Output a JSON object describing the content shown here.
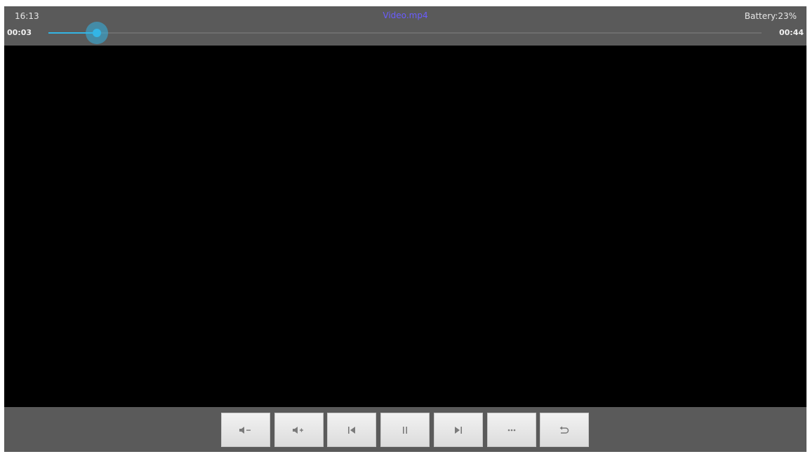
{
  "status_bar": {
    "clock": "16:13",
    "title": "Video.mp4",
    "battery": "Battery:23%"
  },
  "playback": {
    "elapsed": "00:03",
    "total": "00:44",
    "progress_fraction": 0.0682
  },
  "controls": [
    {
      "name": "volume-down-button",
      "icon": "volume-down-icon"
    },
    {
      "name": "volume-up-button",
      "icon": "volume-up-icon"
    },
    {
      "name": "previous-button",
      "icon": "skip-previous-icon"
    },
    {
      "name": "pause-button",
      "icon": "pause-icon"
    },
    {
      "name": "next-button",
      "icon": "skip-next-icon"
    },
    {
      "name": "more-button",
      "icon": "more-dots-icon"
    },
    {
      "name": "back-button",
      "icon": "return-arrow-icon"
    }
  ],
  "colors": {
    "bar_background": "#5a5a5a",
    "accent": "#33b5e5",
    "title": "#6a5cff",
    "video_background": "#000000"
  }
}
